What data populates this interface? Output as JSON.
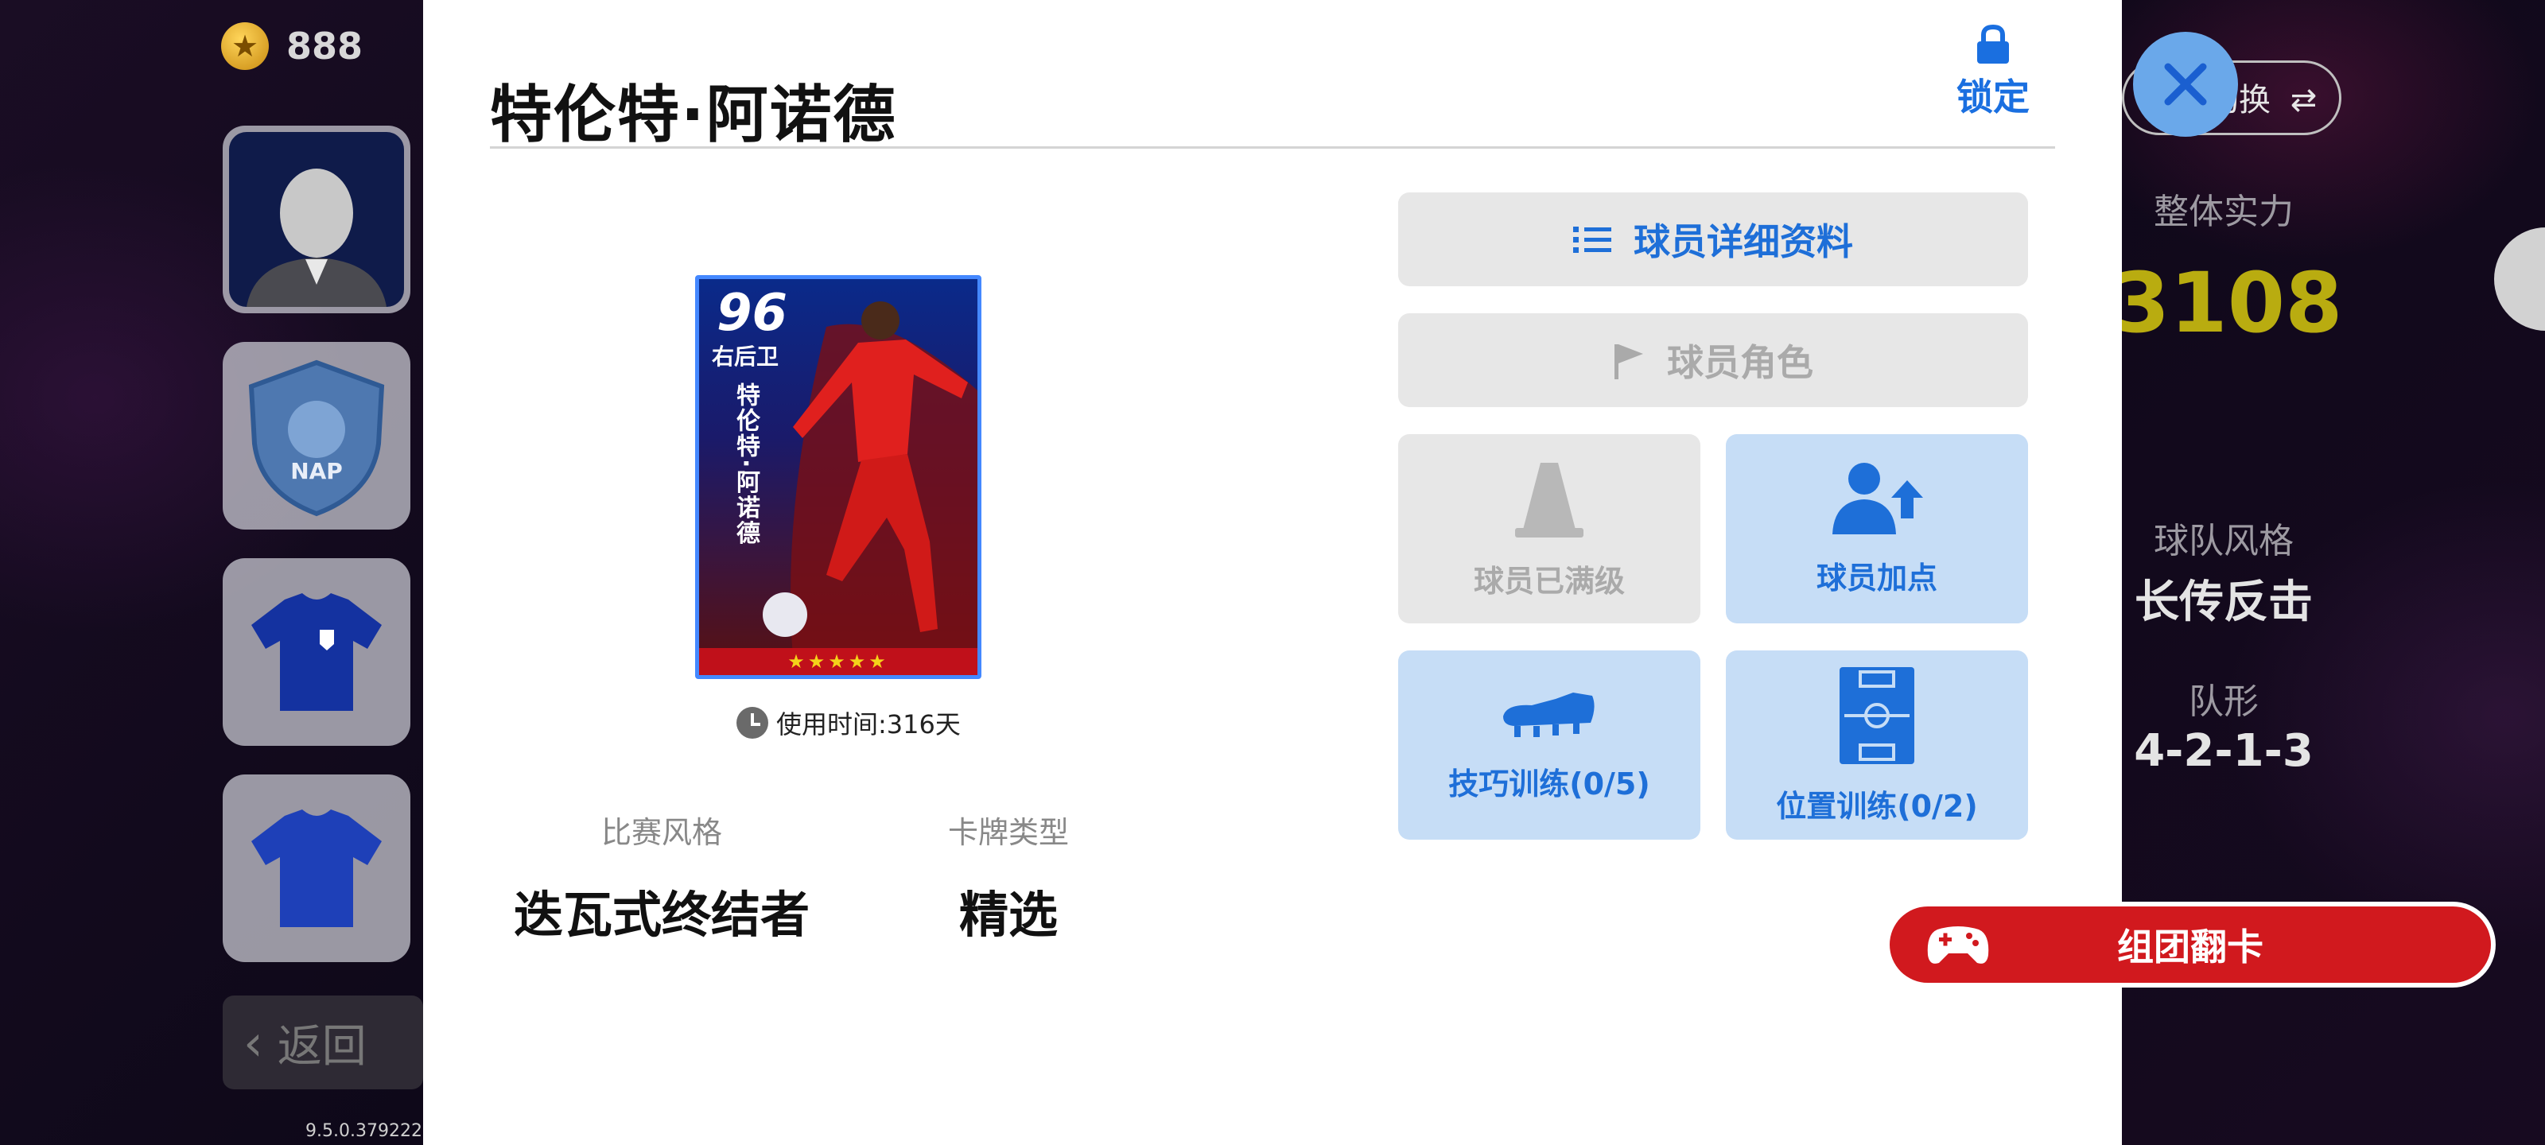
{
  "currency": {
    "icon": "star-coin-icon",
    "amount": "888"
  },
  "left_nav": {
    "items": [
      {
        "name": "coach-avatar",
        "icon": "coach-portrait-icon"
      },
      {
        "name": "team-emblem",
        "icon": "shield-emblem-icon",
        "emblem_text": "NAP"
      },
      {
        "name": "home-kit",
        "icon": "jersey-icon"
      },
      {
        "name": "away-kit",
        "icon": "jersey-icon"
      }
    ],
    "back_label": "返回",
    "version": "9.5.0.379222("
  },
  "right_panel": {
    "switch_pill_label": "阵容切换",
    "strength_label": "整体实力",
    "strength_value": "3108",
    "team_style_label": "球队风格",
    "team_style_value": "长传反击",
    "formation_label": "队形",
    "formation_value": "4-2-1-3"
  },
  "dialog": {
    "player_name": "特伦特·阿诺德",
    "lock_label": "锁定",
    "card": {
      "rating": "96",
      "position": "右后卫",
      "name": "特伦特·阿诺德",
      "stars": "★★★★★",
      "accent_color": "#4488ff"
    },
    "usage_time": "使用时间:316天",
    "attributes": [
      {
        "label": "比赛风格",
        "value": "迭瓦式终结者"
      },
      {
        "label": "卡牌类型",
        "value": "精选"
      }
    ],
    "actions": {
      "details": {
        "label": "球员详细资料",
        "icon": "list-icon",
        "enabled": true
      },
      "role": {
        "label": "球员角色",
        "icon": "flag-icon",
        "enabled": false
      },
      "max_level": {
        "label": "球员已满级",
        "icon": "training-cone-icon",
        "enabled": false
      },
      "add_points": {
        "label": "球员加点",
        "icon": "player-upgrade-icon",
        "enabled": true
      },
      "skill_training": {
        "label": "技巧训练(0/5)",
        "icon": "football-boot-icon",
        "enabled": true
      },
      "position_training": {
        "label": "位置训练(0/2)",
        "icon": "pitch-icon",
        "enabled": true
      }
    }
  },
  "gacha_banner": {
    "label": "组团翻卡",
    "icon": "gamepad-icon",
    "color": "#d1191e"
  },
  "colors": {
    "accent_blue": "#1e6fd8",
    "tile_blue": "#c6ddf6",
    "tile_grey": "#e7e7e7"
  }
}
